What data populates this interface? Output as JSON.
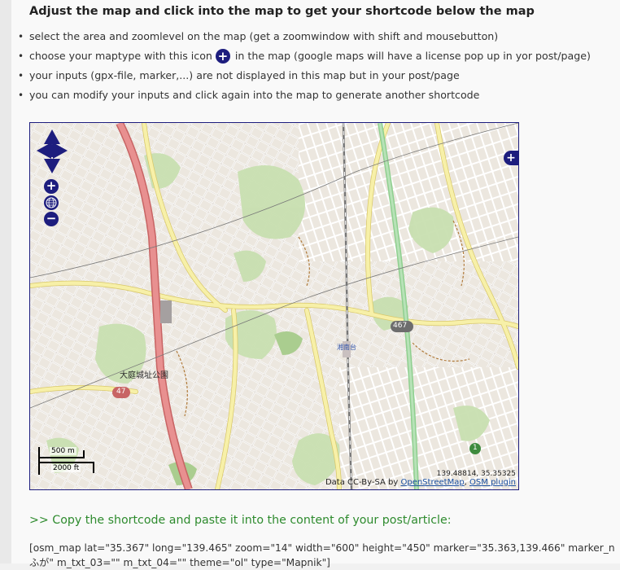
{
  "heading": "Adjust the map and click into the map to get your shortcode below the map",
  "bullets": {
    "b1": "select the area and zoomlevel on the map (get a zoomwindow with shift and mousebutton)",
    "b2_before": "choose your maptype with this icon",
    "b2_after": "in the map (google maps will have a license pop up in yor post/page)",
    "b3": "your inputs (gpx-file, marker,...) are not displayed in this map but in your post/page",
    "b4": "you can modify your inputs and click again into the map to generate another shortcode"
  },
  "map": {
    "place_label": "大庭城址公園",
    "road_shield_1": "467",
    "road_shield_2": "47",
    "road_shield_3": "1",
    "station_label": "湘南台",
    "scale_m": "500 m",
    "scale_ft": "2000 ft",
    "mouse_position": "139.48814, 35.35325",
    "attribution_prefix": "Data CC-By-SA by",
    "attribution_link1": "OpenStreetMap",
    "attribution_sep": ",",
    "attribution_link2": "OSM plugin",
    "controls": {
      "zoom_in": "+",
      "zoom_out": "−",
      "layer_switcher": "+"
    }
  },
  "copy_heading": ">> Copy the shortcode and paste it into the content of your post/article:",
  "shortcode_line1": "[osm_map lat=\"35.367\" long=\"139.465\" zoom=\"14\" width=\"600\" height=\"450\" marker=\"35.363,139.466\" marker_n",
  "shortcode_line2": "ふが\" m_txt_03=\"\" m_txt_04=\"\" theme=\"ol\" type=\"Mapnik\"]",
  "colors": {
    "control_blue": "#1d1d7e",
    "green_heading": "#2e8b2e",
    "road_red": "#e07a7a",
    "road_yellow": "#f7f0a8",
    "rail_green": "#8fcf8f",
    "park_green": "#c8dfb0"
  },
  "icons": {
    "inline": "layer-switcher-plus-icon",
    "pan": "pan-arrows-icon",
    "globe": "world-zoom-icon"
  }
}
